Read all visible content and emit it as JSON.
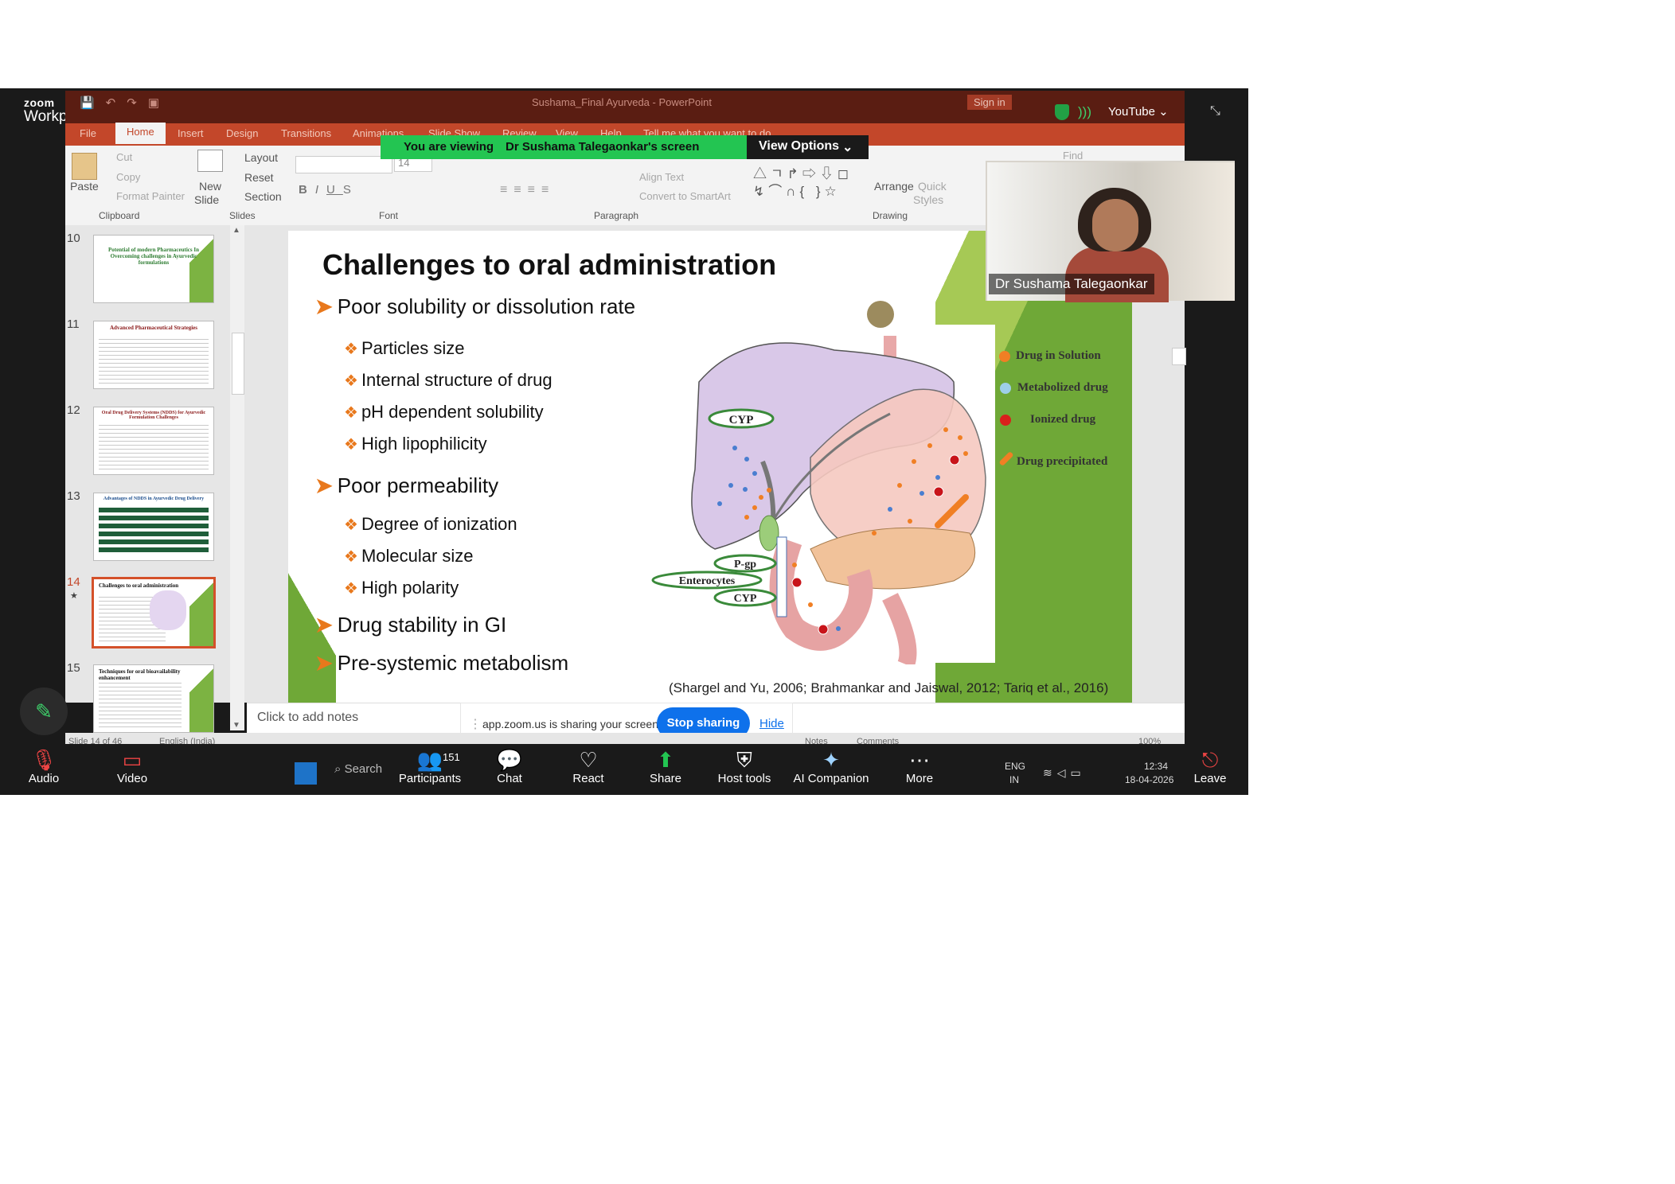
{
  "zoom": {
    "brand_line1": "zoom",
    "brand_line2": "Workplace",
    "top_right_label": "YouTube",
    "viewing_banner_prefix": "You are viewing",
    "viewing_banner_name": "Dr Sushama Talegaonkar's screen",
    "view_options": "View Options",
    "participant_name": "Dr Sushama Talegaonkar",
    "share_message": "app.zoom.us is sharing your screen.",
    "stop_sharing": "Stop sharing",
    "hide": "Hide",
    "toolbar": {
      "audio": "Audio",
      "video": "Video",
      "participants": "Participants",
      "participants_count": "151",
      "chat": "Chat",
      "react": "React",
      "share": "Share",
      "host_tools": "Host tools",
      "ai_companion": "AI Companion",
      "more": "More",
      "leave": "Leave"
    },
    "taskbar": {
      "search": "Search",
      "lang_line1": "ENG",
      "lang_line2": "IN",
      "time": "12:34",
      "date": "18-04-2026"
    }
  },
  "ppt": {
    "window_title": "Sushama_Final Ayurveda - PowerPoint",
    "sign_in": "Sign in",
    "tabs": [
      "File",
      "Home",
      "Insert",
      "Design",
      "Transitions",
      "Animations",
      "Slide Show",
      "Review",
      "View",
      "Help"
    ],
    "tell_me": "Tell me what you want to do",
    "ribbon": {
      "paste": "Paste",
      "cut": "Cut",
      "copy": "Copy",
      "format_painter": "Format Painter",
      "clipboard": "Clipboard",
      "new_slide_1": "New",
      "new_slide_2": "Slide",
      "layout": "Layout",
      "reset": "Reset",
      "section": "Section",
      "slides": "Slides",
      "font_size": "14",
      "font": "Font",
      "align_text": "Align Text",
      "convert_smartart": "Convert to SmartArt",
      "paragraph": "Paragraph",
      "arrange": "Arrange",
      "quick_styles_1": "Quick",
      "quick_styles_2": "Styles",
      "drawing": "Drawing",
      "find": "Find"
    },
    "thumbnails": [
      {
        "num": "10",
        "title": "Potential of modern Pharmaceutics In Overcoming challenges in Ayurvedic formulations"
      },
      {
        "num": "11",
        "title": "Advanced Pharmaceutical Strategies"
      },
      {
        "num": "12",
        "title": "Oral Drug Delivery Systems (NDDS) for Ayurvedic Formulation Challenges"
      },
      {
        "num": "13",
        "title": "Advantages of NDDS in Ayurvedic Drug Delivery"
      },
      {
        "num": "14",
        "title": "Challenges to oral administration"
      },
      {
        "num": "15",
        "title": "Techniques for oral bioavailability enhancement"
      }
    ],
    "notes_placeholder": "Click to add notes",
    "status_slide": "Slide 14 of 46",
    "status_lang": "English (India)",
    "status_notes": "Notes",
    "status_comments": "Comments",
    "zoom_level": "100%"
  },
  "slide": {
    "title": "Challenges to oral administration",
    "sections": [
      {
        "heading": "Poor solubility or dissolution rate",
        "items": [
          "Particles size",
          "Internal structure of drug",
          "pH  dependent solubility",
          "High lipophilicity"
        ]
      },
      {
        "heading": "Poor permeability",
        "items": [
          "Degree of ionization",
          "Molecular size",
          "High polarity"
        ]
      },
      {
        "heading": "Drug stability in GI",
        "items": []
      },
      {
        "heading": "Pre-systemic metabolism",
        "items": []
      }
    ],
    "figure_labels": {
      "cyp_liver": "CYP",
      "pgp": "P-gp",
      "enterocytes": "Enterocytes",
      "cyp_gut": "CYP"
    },
    "legend": [
      {
        "label": "Drug in Solution",
        "color": "#f07f24"
      },
      {
        "label": "Metabolized drug",
        "color": "#9ecfe8"
      },
      {
        "label": "Ionized drug",
        "color": "#d9201c"
      },
      {
        "label": "Drug precipitated",
        "color": "#f07f24"
      }
    ],
    "citation": "(Shargel and Yu, 2006; Brahmankar and Jaiswal, 2012; Tariq et al., 2016)"
  }
}
